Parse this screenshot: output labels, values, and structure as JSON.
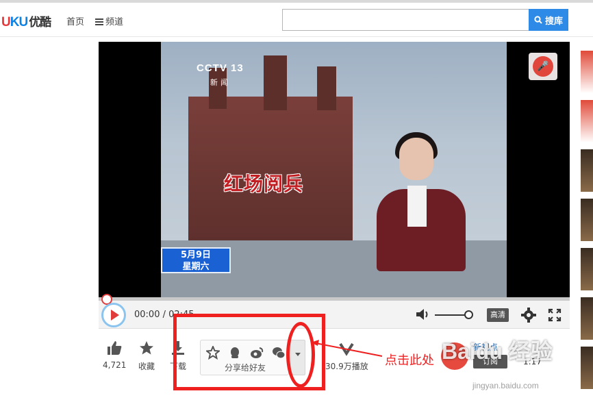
{
  "header": {
    "logo": {
      "prefix": "U",
      "middle": "KU",
      "cn": "优酷"
    },
    "nav": {
      "home": "首页",
      "channel": "频道"
    },
    "search": {
      "placeholder": "",
      "button_label": "搜库"
    }
  },
  "video": {
    "channel_logo": "CCTV 13",
    "channel_sub": "新闻",
    "headline": "红场阅兵",
    "date_line1": "5月9日",
    "date_line2": "星期六"
  },
  "controls": {
    "time": "00:00 / 02:45",
    "quality": "高清",
    "progress": 0.0
  },
  "actions": {
    "like_count": "4,721",
    "favorite_label": "收藏",
    "download_label": "下载",
    "share_label": "分享给好友",
    "plays": "30.9万播放"
  },
  "channel": {
    "name": "新视点",
    "subscribe_label": "订阅",
    "time": "1:17"
  },
  "annotation": {
    "text": "点击此处"
  },
  "watermark": {
    "text": "Baidu 经验",
    "url": "jingyan.baidu.com"
  },
  "colors": {
    "accent": "#2d8ae6",
    "annotation_red": "#ee2020",
    "play_red": "#e03c3c"
  },
  "icons": [
    "menu-icon",
    "search-icon",
    "play-icon",
    "volume-icon",
    "gear-icon",
    "fullscreen-icon",
    "thumb-up-icon",
    "star-icon",
    "download-icon",
    "qzone-icon",
    "qq-icon",
    "weibo-icon",
    "wechat-icon",
    "caret-down-icon",
    "views-icon"
  ]
}
